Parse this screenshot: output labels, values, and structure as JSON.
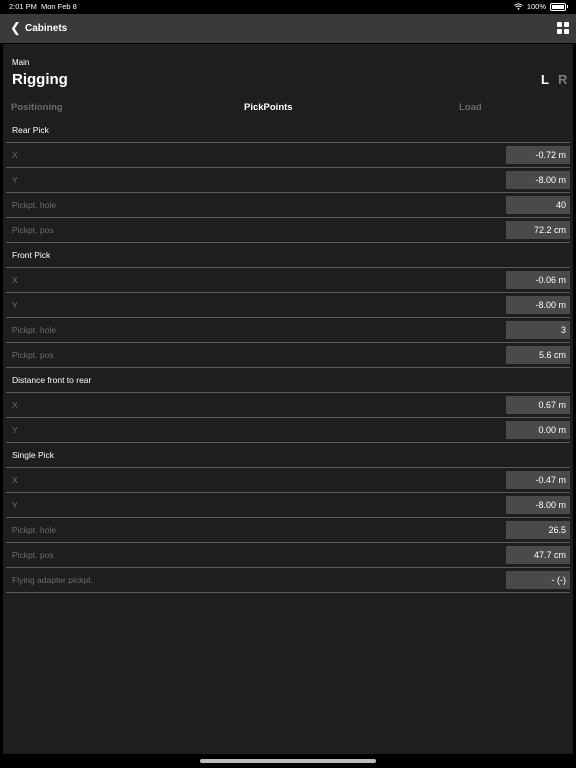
{
  "status": {
    "time": "2:01 PM",
    "date": "Mon Feb 8",
    "battery": "100%"
  },
  "nav": {
    "back_icon": "chevron-left-icon",
    "title": "Cabinets",
    "menu_icon": "grid-icon"
  },
  "header": {
    "section": "Main",
    "title": "Rigging",
    "left_label": "L",
    "right_label": "R"
  },
  "tabs": [
    {
      "label": "Positioning",
      "active": false
    },
    {
      "label": "PickPoints",
      "active": true
    },
    {
      "label": "Load",
      "active": false
    }
  ],
  "groups": [
    {
      "title": "Rear Pick",
      "rows": [
        {
          "label": "X",
          "value": "-0.72 m"
        },
        {
          "label": "Y",
          "value": "-8.00 m"
        },
        {
          "label": "Pickpt. hole",
          "value": "40"
        },
        {
          "label": "Pickpt. pos",
          "value": "72.2 cm"
        }
      ]
    },
    {
      "title": "Front Pick",
      "rows": [
        {
          "label": "X",
          "value": "-0.06 m"
        },
        {
          "label": "Y",
          "value": "-8.00 m"
        },
        {
          "label": "Pickpt. hole",
          "value": "3"
        },
        {
          "label": "Pickpt. pos",
          "value": "5.6 cm"
        }
      ]
    },
    {
      "title": "Distance front to rear",
      "rows": [
        {
          "label": "X",
          "value": "0.67 m"
        },
        {
          "label": "Y",
          "value": "0.00 m"
        }
      ]
    },
    {
      "title": "Single Pick",
      "rows": [
        {
          "label": "X",
          "value": "-0.47 m"
        },
        {
          "label": "Y",
          "value": "-8.00 m"
        },
        {
          "label": "Pickpt. hole",
          "value": "26.5"
        },
        {
          "label": "Pickpt. pos",
          "value": "47.7 cm"
        },
        {
          "label": "Flying adapter pickpt.",
          "value": "- (-)"
        }
      ]
    }
  ]
}
